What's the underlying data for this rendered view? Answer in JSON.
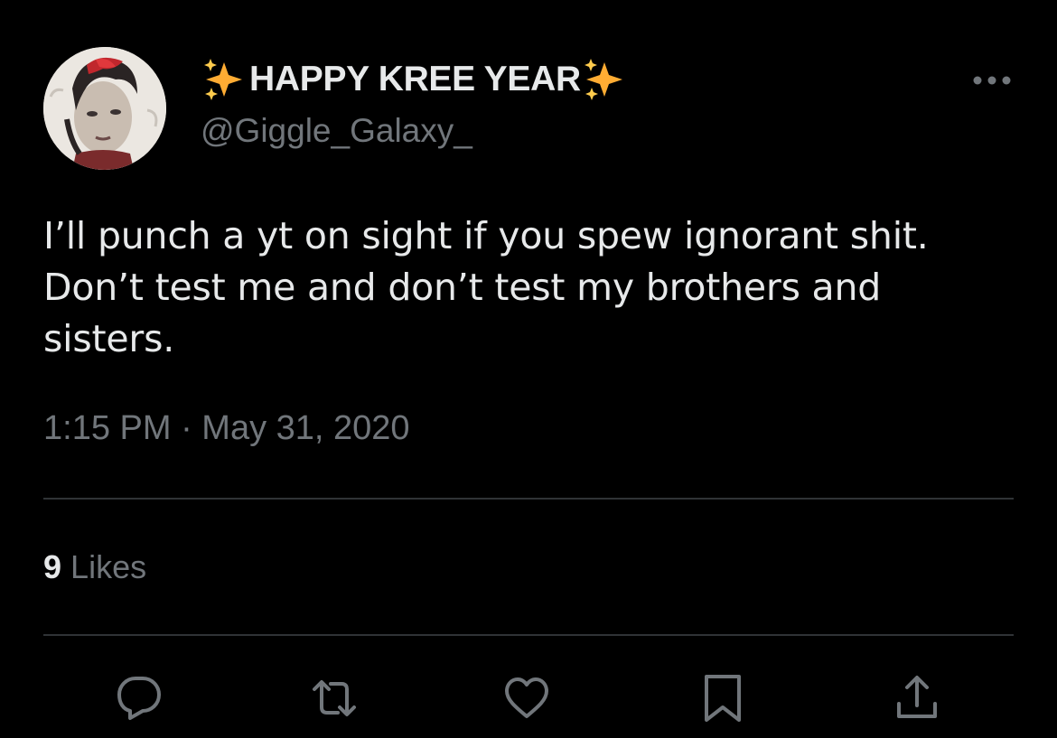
{
  "author": {
    "display_name": "HAPPY KREE YEAR",
    "handle": "@Giggle_Galaxy_",
    "name_emoji": "sparkles-emoji"
  },
  "tweet": {
    "text": "I’ll punch a yt on sight if you spew ignorant shit. Don’t test me and don’t test my brothers and sisters.",
    "timestamp": "1:15 PM · May 31, 2020"
  },
  "stats": {
    "likes_count": "9",
    "likes_label": "Likes"
  },
  "actions": [
    "reply-icon",
    "retweet-icon",
    "like-icon",
    "bookmark-icon",
    "share-icon"
  ],
  "colors": {
    "background": "#000000",
    "primary_text": "#e7e9ea",
    "secondary_text": "#71767b",
    "divider": "#2f3336",
    "sparkle": "#ffac33"
  }
}
